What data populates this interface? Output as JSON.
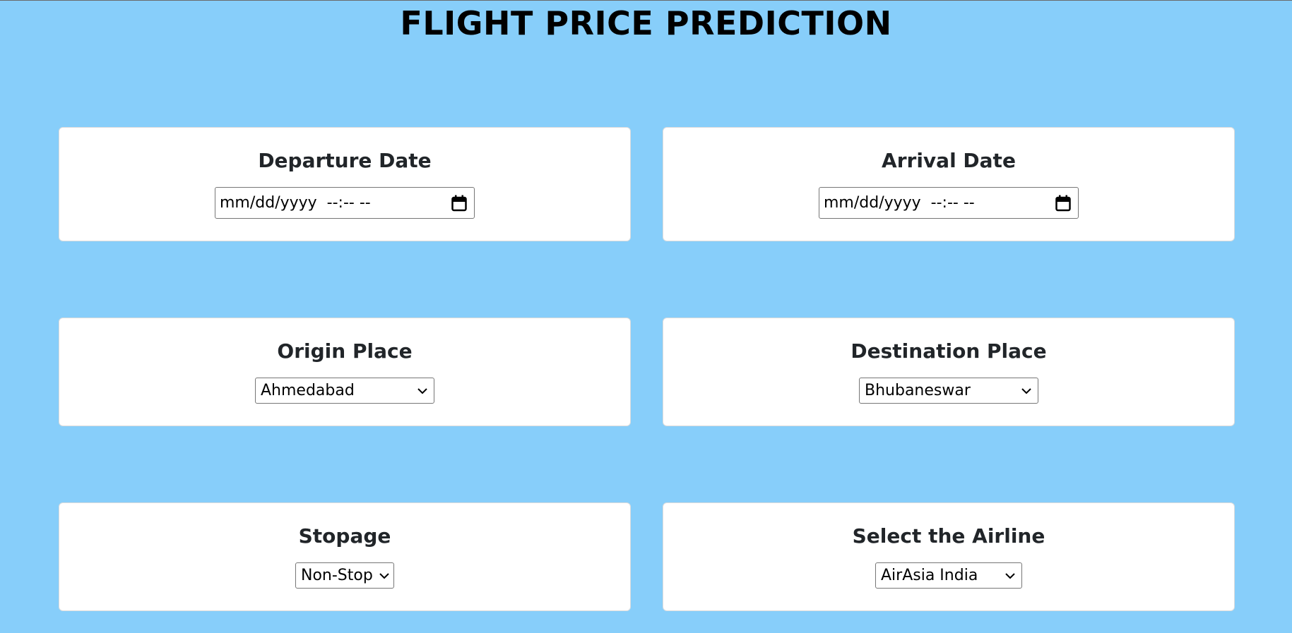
{
  "page": {
    "title": "FLIGHT PRICE PREDICTION"
  },
  "fields": {
    "departure": {
      "label": "Departure Date",
      "placeholder": "mm/dd/yyyy  --:-- --",
      "icon": "calendar-icon"
    },
    "arrival": {
      "label": "Arrival Date",
      "placeholder": "mm/dd/yyyy  --:-- --",
      "icon": "calendar-icon"
    },
    "origin": {
      "label": "Origin Place",
      "selected": "Ahmedabad",
      "icon": "chevron-down-icon"
    },
    "destination": {
      "label": "Destination Place",
      "selected": "Bhubaneswar",
      "icon": "chevron-down-icon"
    },
    "stopage": {
      "label": "Stopage",
      "selected": "Non-Stop",
      "icon": "chevron-down-icon"
    },
    "airline": {
      "label": "Select the Airline",
      "selected": "AirAsia India",
      "icon": "chevron-down-icon"
    }
  },
  "colors": {
    "background": "#87cefa",
    "card": "#ffffff",
    "label_text": "#212529",
    "title_text": "#000000"
  }
}
